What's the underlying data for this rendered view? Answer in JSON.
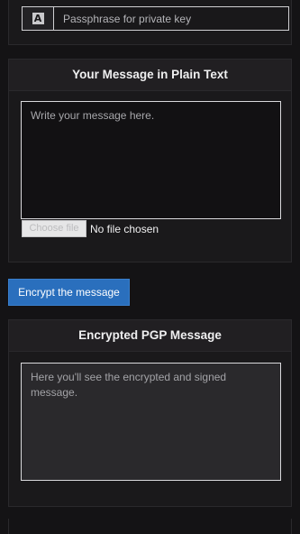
{
  "passphrase": {
    "icon": "font-icon",
    "icon_glyph": "A",
    "placeholder": "Passphrase for private key"
  },
  "plain_panel": {
    "title": "Your Message in Plain Text",
    "textarea_placeholder": "Write your message here.",
    "file_button_label": "Choose file",
    "file_status": "No file chosen"
  },
  "encrypt_button": {
    "label": "Encrypt the message",
    "color": "#2a6fbd"
  },
  "encrypted_panel": {
    "title": "Encrypted PGP Message",
    "output_placeholder": "Here you'll see the encrypted and signed message."
  }
}
